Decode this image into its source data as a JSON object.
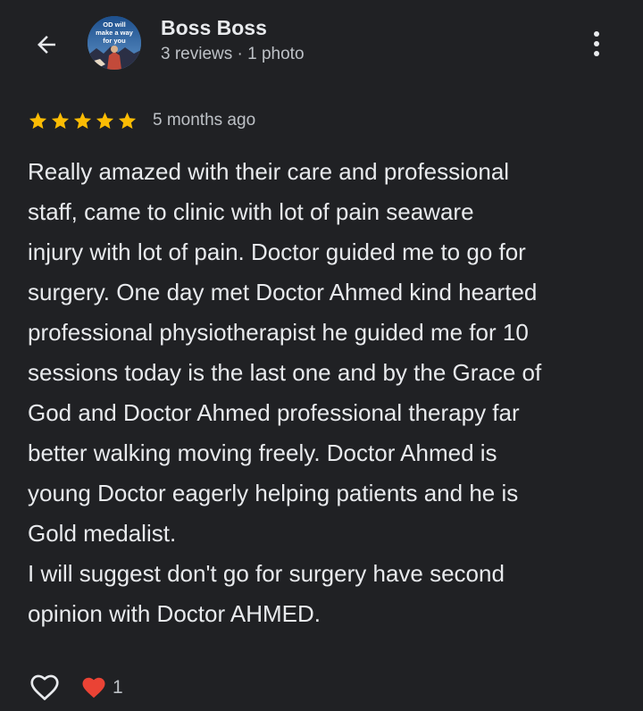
{
  "header": {
    "author_name": "Boss Boss",
    "author_meta": "3 reviews · 1 photo",
    "avatar_text": [
      "OD will",
      "make a way",
      "for you"
    ]
  },
  "review": {
    "rating": 5,
    "max_rating": 5,
    "date": "5 months ago",
    "text": "Really amazed with their care and professional\nstaff, came to clinic with lot of pain seaware\ninjury with lot of pain. Doctor guided me to go for\nsurgery. One day met Doctor Ahmed kind hearted\nprofessional physiotherapist he guided me for 10\nsessions today is the last one and by the Grace of\nGod and Doctor Ahmed professional therapy far\nbetter walking moving freely. Doctor Ahmed is\nyoung Doctor eagerly helping patients and he is\nGold medalist.\nI will suggest don't go for surgery have second\nopinion with Doctor AHMED."
  },
  "actions": {
    "reaction_count": "1"
  },
  "colors": {
    "background": "#202124",
    "star": "#fbbc04",
    "heart": "#ea4335",
    "text_primary": "#e8eaed",
    "text_secondary": "#bdc1c6"
  },
  "icons": {
    "back": "arrow-left-icon",
    "more": "more-vertical-icon",
    "star": "star-icon",
    "like": "heart-outline-icon",
    "reaction": "heart-filled-icon"
  }
}
